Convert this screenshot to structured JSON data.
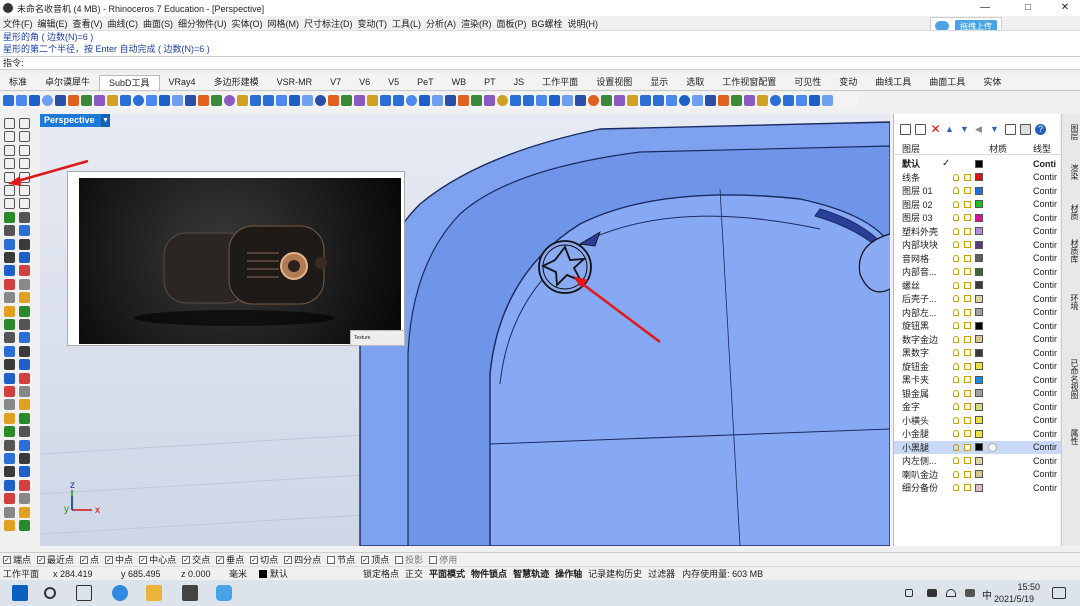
{
  "window": {
    "title": "未命名收音机 (4 MB) - Rhinoceros 7 Education - [Perspective]",
    "min": "—",
    "max": "□",
    "close": "✕"
  },
  "menu": [
    "文件(F)",
    "编辑(E)",
    "查看(V)",
    "曲线(C)",
    "曲面(S)",
    "细分物件(U)",
    "实体(O)",
    "网格(M)",
    "尺寸标注(D)",
    "变动(T)",
    "工具(L)",
    "分析(A)",
    "渲染(R)",
    "面板(P)",
    "BG螺栓",
    "说明(H)"
  ],
  "upload": {
    "label": "拖拽上传"
  },
  "command": {
    "history1": "星形的角 ( 边数(N)=6 )",
    "history2": "星形的第二个半径，按 Enter 自动完成 ( 边数(N)=6 )",
    "prompt": "指令:"
  },
  "tabs": [
    "标准",
    "卓尔谟犀牛",
    "SubD工具",
    "VRay4",
    "多边形建模",
    "VSR-MR",
    "V7",
    "V6",
    "V5",
    "PeT",
    "WB",
    "PT",
    "JS",
    "工作平面",
    "设置视图",
    "显示",
    "选取",
    "工作视窗配置",
    "可见性",
    "变动",
    "曲线工具",
    "曲面工具",
    "实体"
  ],
  "active_tab": "SubD工具",
  "viewport": {
    "label": "Perspective",
    "axis_x": "x",
    "axis_y": "y",
    "axis_z": "z",
    "thumb_cursor_text": "Texture"
  },
  "layers": {
    "col_layer": "图层",
    "col_material": "材质",
    "col_linetype": "线型",
    "rows": [
      {
        "name": "默认",
        "color": "#000000",
        "linetype": "Conti",
        "current": true
      },
      {
        "name": "线条",
        "color": "#e01010",
        "linetype": "Contir"
      },
      {
        "name": "图层 01",
        "color": "#1f6fe0",
        "linetype": "Contir"
      },
      {
        "name": "图层 02",
        "color": "#1ec21e",
        "linetype": "Contir"
      },
      {
        "name": "图层 03",
        "color": "#e0109a",
        "linetype": "Contir"
      },
      {
        "name": "塑料外壳",
        "color": "#b48be0",
        "linetype": "Contir"
      },
      {
        "name": "内部块块",
        "color": "#5a3a7a",
        "linetype": "Contir"
      },
      {
        "name": "音网格",
        "color": "#606060",
        "linetype": "Contir"
      },
      {
        "name": "内部音...",
        "color": "#3a6a3a",
        "linetype": "Contir"
      },
      {
        "name": "螺丝",
        "color": "#3a3a3a",
        "linetype": "Contir"
      },
      {
        "name": "后壳子...",
        "color": "#d8d8a0",
        "linetype": "Contir"
      },
      {
        "name": "内部左...",
        "color": "#a0a0a0",
        "linetype": "Contir"
      },
      {
        "name": "旋钮黑",
        "color": "#000000",
        "linetype": "Contir"
      },
      {
        "name": "数字金边",
        "color": "#d8c890",
        "linetype": "Contir"
      },
      {
        "name": "黑数字",
        "color": "#3a3a3a",
        "linetype": "Contir"
      },
      {
        "name": "旋钮金",
        "color": "#f0e040",
        "linetype": "Contir"
      },
      {
        "name": "黑卡夹",
        "color": "#1f8ae0",
        "linetype": "Contir"
      },
      {
        "name": "银金属",
        "color": "#a0a0a0",
        "linetype": "Contir"
      },
      {
        "name": "金字",
        "color": "#d8d870",
        "linetype": "Contir"
      },
      {
        "name": "小横头",
        "color": "#f0e040",
        "linetype": "Contir"
      },
      {
        "name": "小金腿",
        "color": "#f0e040",
        "linetype": "Contir"
      },
      {
        "name": "小黑腿",
        "color": "#000000",
        "linetype": "Contir",
        "selected": true
      },
      {
        "name": "内左侧...",
        "color": "#d8d8a0",
        "linetype": "Contir"
      },
      {
        "name": "喇叭金边",
        "color": "#d8c890",
        "linetype": "Contir"
      },
      {
        "name": "细分备份",
        "color": "#e8b8b8",
        "linetype": "Contir"
      }
    ]
  },
  "right_strip": [
    "图层",
    "渲染",
    "材质",
    "材质库",
    "环境",
    "已命名视图",
    "属性"
  ],
  "osnap": [
    {
      "label": "端点",
      "checked": true
    },
    {
      "label": "最近点",
      "checked": true
    },
    {
      "label": "点",
      "checked": true
    },
    {
      "label": "中点",
      "checked": true
    },
    {
      "label": "中心点",
      "checked": true
    },
    {
      "label": "交点",
      "checked": true
    },
    {
      "label": "垂点",
      "checked": true
    },
    {
      "label": "切点",
      "checked": true
    },
    {
      "label": "四分点",
      "checked": true
    },
    {
      "label": "节点",
      "checked": false
    },
    {
      "label": "顶点",
      "checked": true
    },
    {
      "label": "投影",
      "checked": false
    },
    {
      "label": "停用",
      "checked": false
    }
  ],
  "status": {
    "cplane": "工作平面",
    "x": "x 284.419",
    "y": "y 685.495",
    "z": "z 0.000",
    "unit": "毫米",
    "layer": "默认",
    "toggles": [
      "锁定格点",
      "正交",
      "平面模式",
      "物件锁点",
      "智慧轨迹",
      "操作轴",
      "记录建构历史",
      "过滤器"
    ],
    "bold_toggles": [
      "平面模式",
      "物件锁点",
      "智慧轨迹",
      "操作轴"
    ],
    "memory": "内存使用量: 603 MB"
  },
  "taskbar": {
    "time": "15:50",
    "date": "2021/5/19",
    "ime": "中"
  }
}
